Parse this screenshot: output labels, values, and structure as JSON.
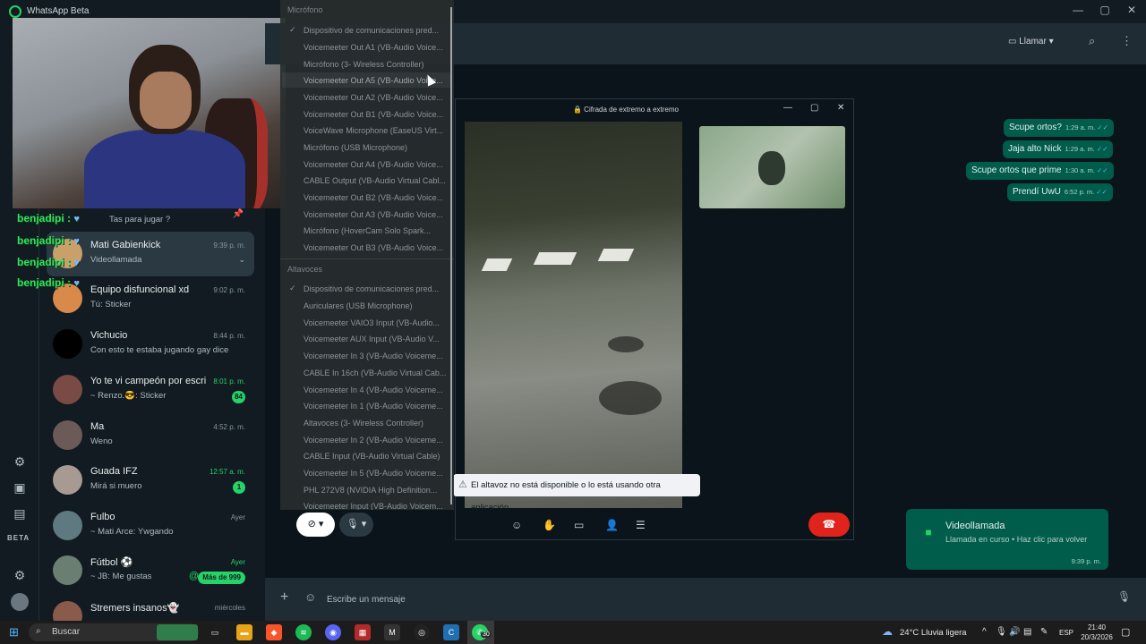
{
  "window": {
    "app_title": "WhatsApp Beta",
    "minimize": "—",
    "maximize": "▢",
    "close": "✕"
  },
  "rail": {
    "beta_label": "BETA"
  },
  "chats": [
    {
      "name": "",
      "time": "",
      "preview": "Tas para jugar ?",
      "pinned": true
    },
    {
      "name": "Mati Gabienkick",
      "time": "9:39 p. m.",
      "preview": "Videollamada",
      "active": true
    },
    {
      "name": "Equipo disfuncional xd",
      "time": "9:02 p. m.",
      "preview": "Tú: Sticker"
    },
    {
      "name": "Vichucio",
      "time": "8:44 p. m.",
      "preview": "Con esto te estaba jugando gay dice"
    },
    {
      "name": "Yo te vi campeón por escri...",
      "time": "8:01 p. m.",
      "preview": "~ Renzo.😎: Sticker",
      "badge": "84"
    },
    {
      "name": "Ma",
      "time": "4:52 p. m.",
      "preview": "Weno"
    },
    {
      "name": "Guada IFZ",
      "time": "12:57 a. m.",
      "preview": "Mirá si muero",
      "badge": "1"
    },
    {
      "name": "Fulbo",
      "time": "Ayer",
      "preview": "~ Mati Arce: Ywgando"
    },
    {
      "name": "Fútbol ⚽",
      "time": "Ayer",
      "preview": "~ JB: Me gustas",
      "badge": "Más de 999"
    },
    {
      "name": "Stremers insanos👻",
      "time": "miércoles",
      "preview": ""
    }
  ],
  "twitch_overlay": {
    "username": "benjadipi",
    "lines": [
      "benjadipi :",
      "benjadipi :",
      "benjadipi :",
      "benjadipi :"
    ]
  },
  "header": {
    "call_label": "Llamar",
    "call_icon": "video-icon",
    "search_icon": "search-icon",
    "menu_icon": "more-vert-icon"
  },
  "messages": [
    {
      "text": "Scupe ortos?",
      "time": "1:29 a. m."
    },
    {
      "text": "Jaja alto Nick",
      "time": "1:29 a. m."
    },
    {
      "text": "Scupe ortos que prime",
      "time": "1:30 a. m."
    },
    {
      "text": "Prendí UwU",
      "time": "6:52 p. m."
    }
  ],
  "video_toast": {
    "title": "Videollamada",
    "subtitle": "Llamada en curso • Haz clic para volver",
    "time": "9:39 p. m."
  },
  "composer": {
    "placeholder": "Escribe un mensaje"
  },
  "call_window": {
    "title": "🔒 Cifrada de extremo a extremo",
    "warning": "El altavoz no está disponible o lo está usando otra aplicación"
  },
  "device_menu": {
    "microphone_section": "Micrófono",
    "microphones": [
      "Dispositivo de comunicaciones pred...",
      "Voicemeeter Out A1 (VB-Audio Voice...",
      "Micrófono (3- Wireless Controller)",
      "Voicemeeter Out A5 (VB-Audio Voice...",
      "Voicemeeter Out A2 (VB-Audio Voice...",
      "Voicemeeter Out B1 (VB-Audio Voice...",
      "VoiceWave Microphone (EaseUS Virt...",
      "Micrófono (USB Microphone)",
      "Voicemeeter Out A4 (VB-Audio Voice...",
      "CABLE Output (VB-Audio Virtual Cabl...",
      "Voicemeeter Out B2 (VB-Audio Voice...",
      "Voicemeeter Out A3 (VB-Audio Voice...",
      "Micrófono (HoverCam Solo Spark...",
      "Voicemeeter Out B3 (VB-Audio Voice..."
    ],
    "speaker_section": "Altavoces",
    "speakers": [
      "Dispositivo de comunicaciones pred...",
      "Auriculares (USB Microphone)",
      "Voicemeeter VAIO3 Input (VB-Audio...",
      "Voicemeeter AUX Input (VB-Audio V...",
      "Voicemeeter In 3 (VB-Audio Voiceme...",
      "CABLE In 16ch (VB-Audio Virtual Cab...",
      "Voicemeeter In 4 (VB-Audio Voiceme...",
      "Voicemeeter In 1 (VB-Audio Voiceme...",
      "Altavoces (3- Wireless Controller)",
      "Voicemeeter In 2 (VB-Audio Voiceme...",
      "CABLE Input (VB-Audio Virtual Cable)",
      "Voicemeeter In 5 (VB-Audio Voiceme...",
      "PHL 272V8 (NVIDIA High Definition...",
      "Voicemeeter Input (VB-Audio Voicem..."
    ]
  },
  "taskbar": {
    "search_label": "Buscar",
    "weather": "24°C  Lluvia ligera",
    "language": "ESP",
    "time": "21:40",
    "date": "20/3/2026",
    "whatsapp_badge": "30"
  }
}
